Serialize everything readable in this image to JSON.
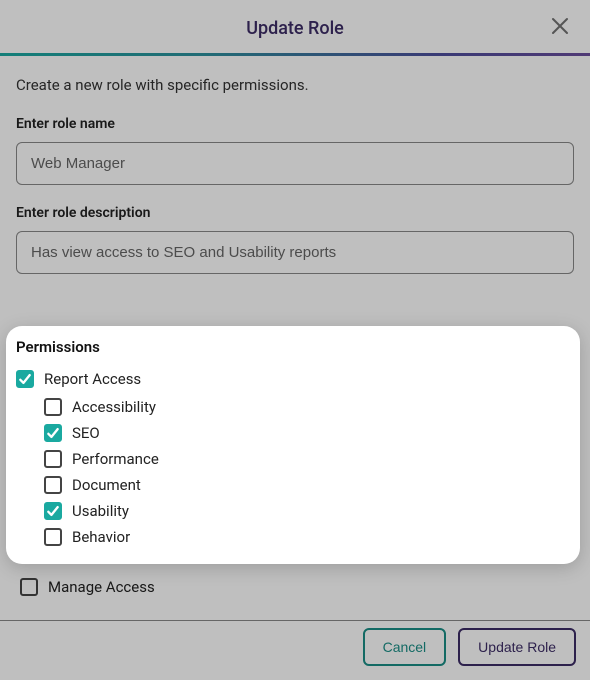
{
  "dialog": {
    "title": "Update Role",
    "intro": "Create a new role with specific permissions.",
    "close_label": "Close"
  },
  "fields": {
    "name_label": "Enter role name",
    "name_value": "Web Manager",
    "desc_label": "Enter role description",
    "desc_value": "Has view access to SEO and Usability reports"
  },
  "permissions": {
    "section_label": "Permissions",
    "report_access": {
      "label": "Report Access",
      "checked": true
    },
    "children": [
      {
        "id": "accessibility",
        "label": "Accessibility",
        "checked": false
      },
      {
        "id": "seo",
        "label": "SEO",
        "checked": true
      },
      {
        "id": "performance",
        "label": "Performance",
        "checked": false
      },
      {
        "id": "document",
        "label": "Document",
        "checked": false
      },
      {
        "id": "usability",
        "label": "Usability",
        "checked": true
      },
      {
        "id": "behavior",
        "label": "Behavior",
        "checked": false
      }
    ],
    "manage_access": {
      "label": "Manage Access",
      "checked": false
    }
  },
  "footer": {
    "cancel": "Cancel",
    "submit": "Update Role"
  }
}
